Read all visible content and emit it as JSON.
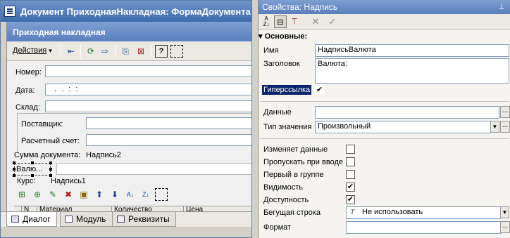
{
  "doc_window": {
    "title": "Документ ПриходнаяНакладная: ФормаДокумента",
    "form_title": "Приходная накладная",
    "toolbar": {
      "actions_label": "Действия"
    },
    "fields": {
      "number_label": "Номер:",
      "date_label": "Дата:",
      "date_value": ". .   : :",
      "warehouse_label": "Склад:",
      "supplier_label": "Поставщик:",
      "account_label": "Расчетный счет:",
      "total_label": "Сумма документа:",
      "total_value": "Надпись2",
      "selected_label": "Валю...",
      "rate_label": "Курс:",
      "rate_value": "Надпись1"
    },
    "table": {
      "col_1": "N",
      "col_2": "Материал",
      "col_3": "Количество",
      "col_4": "Цена"
    },
    "tabs": [
      "Диалог",
      "Модуль",
      "Реквизиты"
    ]
  },
  "props": {
    "title": "Свойства: Надпись",
    "pin": "⊥",
    "section_label": "Основные:",
    "rows": {
      "name_label": "Имя",
      "name_value": "НадписьВалюта",
      "caption_label": "Заголовок",
      "caption_value": "Валюта:",
      "hyperlink_label": "Гиперссылка",
      "data_label": "Данные",
      "data_value": "",
      "valtype_label": "Тип значения",
      "valtype_value": "Произвольный",
      "changes_label": "Изменяет данные",
      "skip_label": "Пропускать при вводе",
      "first_label": "Первый в группе",
      "visible_label": "Видимость",
      "enabled_label": "Доступность",
      "ticker_label": "Бегущая строка",
      "ticker_value": "Не использовать",
      "format_label": "Формат"
    },
    "checks": {
      "hyperlink": true,
      "changes": false,
      "skip": false,
      "first": false,
      "visible": true,
      "enabled": true
    }
  },
  "colors": {
    "title_blue": "#3d6bab",
    "selection": "#0a246a"
  }
}
